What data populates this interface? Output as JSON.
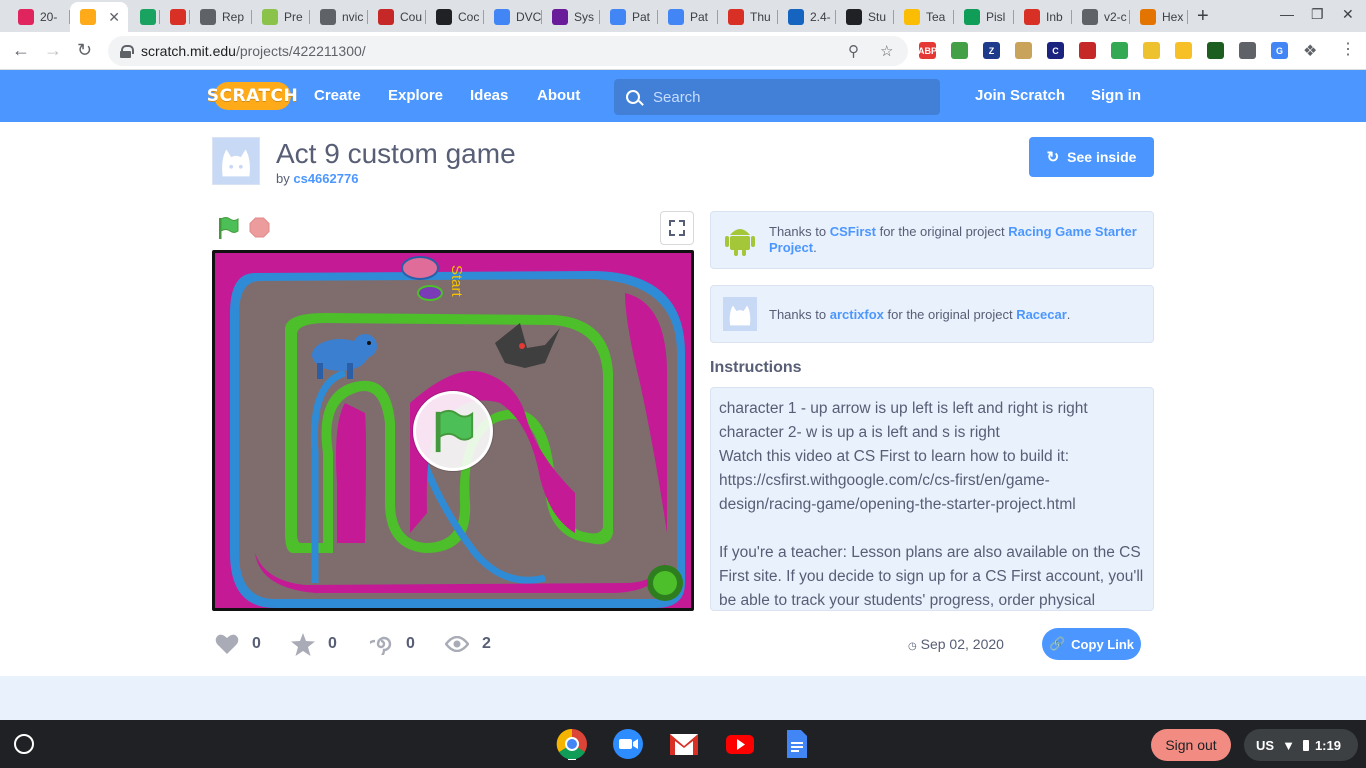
{
  "browser": {
    "tabs": [
      {
        "label": "20-",
        "color": "#e0245e"
      },
      {
        "label": "",
        "color": "#ffab19",
        "active": true
      },
      {
        "label": "",
        "color": "#1aa260"
      },
      {
        "label": "",
        "color": "#d93025"
      },
      {
        "label": "Rep",
        "color": "#5f6368"
      },
      {
        "label": "Pre",
        "color": "#8bc34a"
      },
      {
        "label": "nvic",
        "color": "#5f6368"
      },
      {
        "label": "Cou",
        "color": "#c62828"
      },
      {
        "label": "Coc",
        "color": "#202124"
      },
      {
        "label": "DVC",
        "color": "#4285f4"
      },
      {
        "label": "Sys",
        "color": "#6a1b9a"
      },
      {
        "label": "Pat",
        "color": "#4285f4"
      },
      {
        "label": "Pat",
        "color": "#4285f4"
      },
      {
        "label": "Thu",
        "color": "#d93025"
      },
      {
        "label": "2.4-",
        "color": "#1565c0"
      },
      {
        "label": "Stu",
        "color": "#202124"
      },
      {
        "label": "Tea",
        "color": "#fbbc04"
      },
      {
        "label": "Pisl",
        "color": "#0f9d58"
      },
      {
        "label": "Inb",
        "color": "#d93025"
      },
      {
        "label": "v2-c",
        "color": "#5f6368"
      },
      {
        "label": "Hex",
        "color": "#e37400"
      }
    ],
    "url_host": "scratch.mit.edu",
    "url_path": "/projects/422211300/",
    "extensions": [
      {
        "name": "abp-extension",
        "label": "ABP",
        "color": "#e53935"
      },
      {
        "name": "save-extension",
        "label": "",
        "color": "#43a047"
      },
      {
        "name": "zotero-extension",
        "label": "Z",
        "color": "#1e3a8a"
      },
      {
        "name": "doge-extension",
        "label": "",
        "color": "#c9a35a"
      },
      {
        "name": "c-extension",
        "label": "C",
        "color": "#1a237e"
      },
      {
        "name": "record-extension",
        "label": "",
        "color": "#c62828"
      },
      {
        "name": "classroom-extension",
        "label": "",
        "color": "#34a853"
      },
      {
        "name": "puzzle-2048-extension",
        "label": "",
        "color": "#edc22e"
      },
      {
        "name": "yellow-extension",
        "label": "",
        "color": "#f6c026"
      },
      {
        "name": "grid-extension",
        "label": "",
        "color": "#1b5e20"
      },
      {
        "name": "pen-extension",
        "label": "",
        "color": "#5f6368"
      },
      {
        "name": "translate-extension",
        "label": "G",
        "color": "#4285f4"
      }
    ]
  },
  "scratch_nav": {
    "logo": "SCRATCH",
    "links": [
      "Create",
      "Explore",
      "Ideas",
      "About"
    ],
    "search_placeholder": "Search",
    "join": "Join Scratch",
    "signin": "Sign in"
  },
  "project": {
    "title": "Act 9 custom game",
    "by_label": "by",
    "author": "cs4662776",
    "see_inside": "See inside",
    "stage_text": "Start",
    "credits": [
      {
        "pre": "Thanks to",
        "user": "CSFirst",
        "mid": "for the original project",
        "project": "Racing Game Starter Project",
        "post": "."
      },
      {
        "pre": "Thanks to",
        "user": "arctixfox",
        "mid": "for the original project",
        "project": "Racecar",
        "post": "."
      }
    ],
    "instructions_heading": "Instructions",
    "instructions_lines": [
      "character 1 - up arrow is up left is left and right is right",
      "character 2- w is up a is left and s is right",
      "Watch this video at CS First to learn how to build it: https://csfirst.withgoogle.com/c/cs-first/en/game-design/racing-game/opening-the-starter-project.html",
      "If you're a teacher: Lesson plans are also available on the CS First site. If you decide to sign up for a CS First account, you'll be able to track your students' progress, order physical"
    ],
    "stats": {
      "loves": "0",
      "favorites": "0",
      "remixes": "0",
      "views": "2"
    },
    "date": "Sep 02, 2020",
    "copy_link": "Copy Link"
  },
  "shelf": {
    "signout": "Sign out",
    "locale": "US",
    "time": "1:19"
  }
}
